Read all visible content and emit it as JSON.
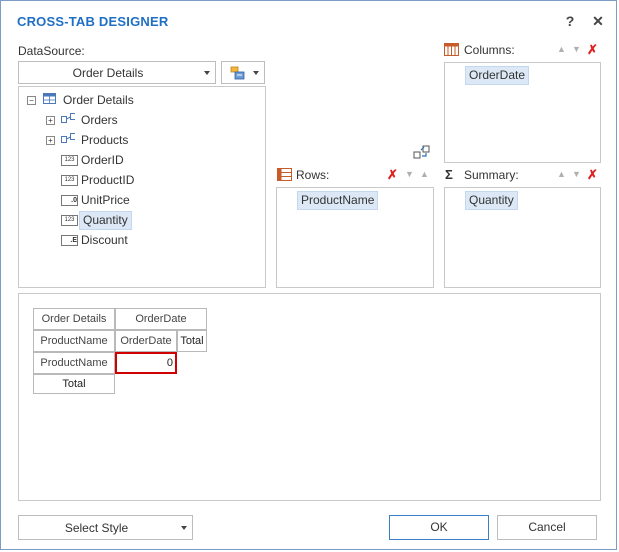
{
  "window": {
    "title": "CROSS-TAB DESIGNER",
    "help": "?",
    "close": "✕"
  },
  "datasource": {
    "label": "DataSource:",
    "selected": "Order Details"
  },
  "tree": {
    "root": "Order Details",
    "items": [
      {
        "label": "Orders",
        "type": "relation",
        "expandable": true
      },
      {
        "label": "Products",
        "type": "relation",
        "expandable": true
      },
      {
        "label": "OrderID",
        "type": "integer"
      },
      {
        "label": "ProductID",
        "type": "integer"
      },
      {
        "label": "UnitPrice",
        "type": "decimal"
      },
      {
        "label": "Quantity",
        "type": "integer",
        "selected": true
      },
      {
        "label": "Discount",
        "type": "float"
      }
    ]
  },
  "columns": {
    "label": "Columns:",
    "fields": [
      "OrderDate"
    ]
  },
  "rows": {
    "label": "Rows:",
    "fields": [
      "ProductName"
    ]
  },
  "summary": {
    "label": "Summary:",
    "fields": [
      "Quantity"
    ]
  },
  "preview": {
    "corner": "Order Details",
    "col_header": "OrderDate",
    "row_header": "ProductName",
    "col_value": "OrderDate",
    "col_total": "Total",
    "row_value": "ProductName",
    "cell_value": "0",
    "row_total": "Total"
  },
  "footer": {
    "style_label": "Select Style",
    "ok": "OK",
    "cancel": "Cancel"
  },
  "icons": {
    "int": "123",
    "dec": ".0",
    "flt": ".E"
  },
  "colors": {
    "accent": "#1f6fc5",
    "selection": "#dce8f5",
    "highlight_cell": "#d00000",
    "delete": "#d22222"
  }
}
